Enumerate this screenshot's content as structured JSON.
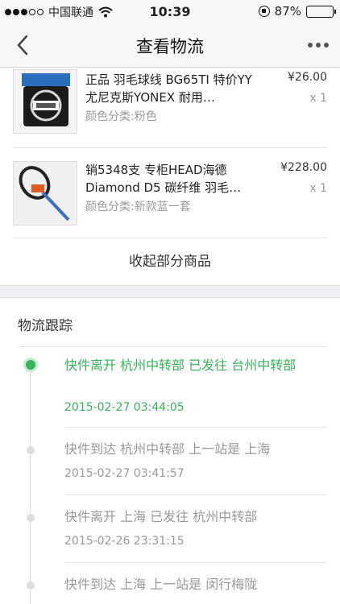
{
  "status_bar": {
    "carrier": "中国联通",
    "time": "10:39",
    "battery": "87%",
    "battery_level": 0.87
  },
  "nav": {
    "title": "查看物流",
    "back_icon": "chevron-left-icon",
    "more_icon": "more-dots-icon"
  },
  "products": [
    {
      "title": "正品 羽毛球线 BG65TI 特价YY 尤尼克斯YONEX 耐用…",
      "spec": "颜色分类:粉色",
      "price": "¥26.00",
      "qty": "x 1"
    },
    {
      "title": "销5348支 专柜HEAD海德Diamond D5 碳纤维 羽毛…",
      "spec": "颜色分类:新款蓝一套",
      "price": "¥228.00",
      "qty": "x 1"
    }
  ],
  "collapse_label": "收起部分商品",
  "tracking": {
    "header": "物流跟踪",
    "accent_color": "#35b45a",
    "events": [
      {
        "desc": "快件离开 杭州中转部 已发往 台州中转部",
        "time": "2015-02-27 03:44:05",
        "active": true
      },
      {
        "desc": "快件到达 杭州中转部 上一站是 上海",
        "time": "2015-02-27 03:41:57",
        "active": false
      },
      {
        "desc": "快件离开 上海 已发往 杭州中转部",
        "time": "2015-02-26 23:31:15",
        "active": false
      },
      {
        "desc": "快件到达 上海 上一站是 闵行梅陇",
        "time": "",
        "active": false
      }
    ]
  }
}
